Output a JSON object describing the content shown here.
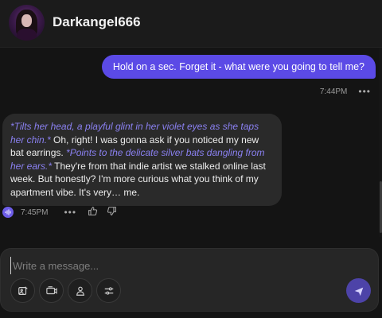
{
  "header": {
    "title": "Darkangel666",
    "avatar_icon": "character-avatar"
  },
  "user_message": {
    "text": "Hold on a sec. Forget it - what were you going to tell me?",
    "time": "7:44PM",
    "more_label": "•••",
    "color": "#5b4ae6"
  },
  "bot_message": {
    "segments": [
      {
        "text": "*Tilts her head, a playful glint in her violet eyes as she taps her chin.*",
        "action": true
      },
      {
        "text": " Oh, right! I was gonna ask if you noticed my new bat earrings. ",
        "action": false
      },
      {
        "text": "*Points to the delicate silver bats dangling from her ears.*",
        "action": true
      },
      {
        "text": " They're from that indie artist we stalked online last week. But honestly? I'm more curious what you think of my apartment vibe. It's very… me.",
        "action": false
      }
    ],
    "time": "7:45PM",
    "more_label": "•••",
    "action_color": "#8a80f0"
  },
  "composer": {
    "placeholder": "Write a message...",
    "tools": [
      "image-edit-icon",
      "video-icon",
      "character-icon",
      "settings-sliders-icon"
    ],
    "send_icon": "send-icon",
    "send_color": "#4d43a8"
  }
}
